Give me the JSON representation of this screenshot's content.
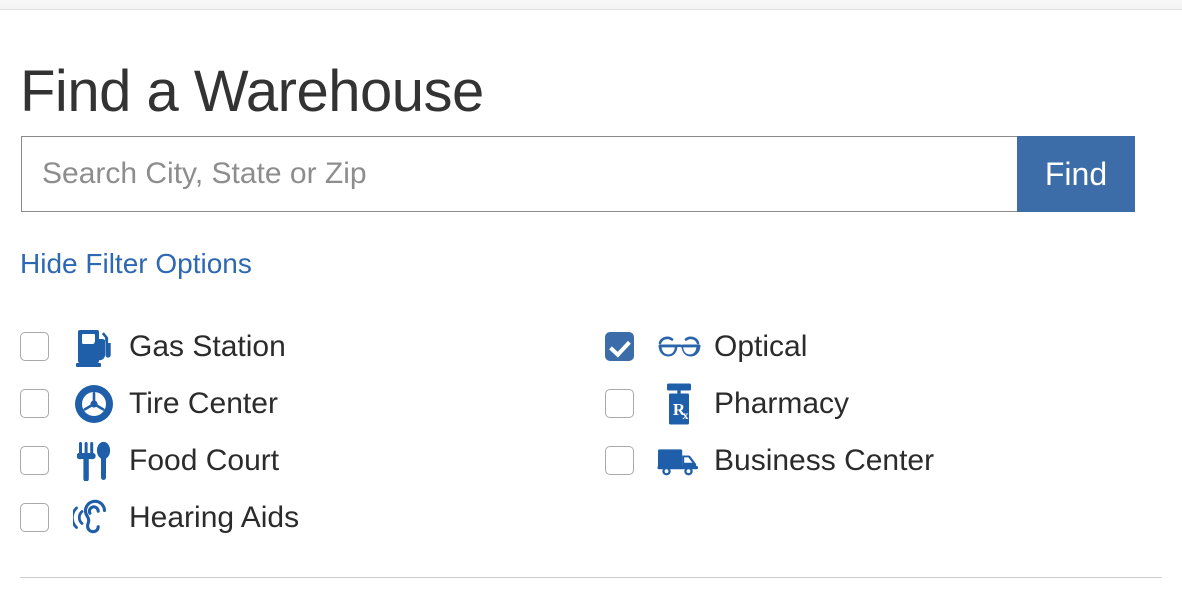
{
  "page": {
    "title": "Find a Warehouse"
  },
  "search": {
    "value": "",
    "placeholder": "Search City, State or Zip",
    "button_label": "Find"
  },
  "filters": {
    "toggle_label": "Hide Filter Options",
    "left_column": [
      {
        "label": "Gas Station",
        "icon": "gas-pump-icon",
        "checked": false
      },
      {
        "label": "Tire Center",
        "icon": "tire-wheel-icon",
        "checked": false
      },
      {
        "label": "Food Court",
        "icon": "fork-spoon-icon",
        "checked": false
      },
      {
        "label": "Hearing Aids",
        "icon": "ear-sound-icon",
        "checked": false
      }
    ],
    "right_column": [
      {
        "label": "Optical",
        "icon": "eyeglasses-icon",
        "checked": true
      },
      {
        "label": "Pharmacy",
        "icon": "rx-pill-bottle-icon",
        "checked": false
      },
      {
        "label": "Business Center",
        "icon": "delivery-truck-icon",
        "checked": false
      }
    ]
  },
  "colors": {
    "accent_blue": "#3d6da8",
    "icon_blue": "#1f5fa9",
    "link_blue": "#2d68b2",
    "title_gray": "#333333",
    "placeholder_gray": "#8d8d8d",
    "input_border": "#8a8a8a",
    "divider": "#cccccc"
  }
}
